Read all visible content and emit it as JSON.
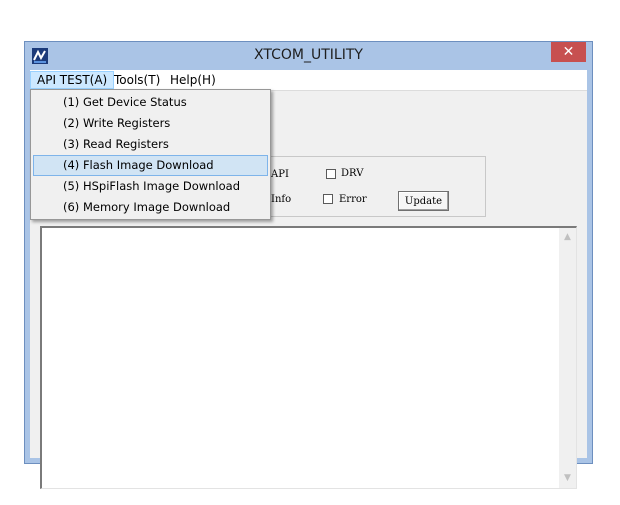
{
  "window": {
    "title": "XTCOM_UTILITY",
    "close_symbol": "✕",
    "icon": "app-logo-icon"
  },
  "menubar": {
    "items": [
      "API TEST(A)",
      "Tools(T)",
      "Help(H)"
    ],
    "active": "API TEST(A)"
  },
  "dropdown": {
    "items": [
      "(1) Get Device Status",
      "(2) Write Registers",
      "(3) Read Registers",
      "(4) Flash Image Download",
      "(5) HSpiFlash Image Download",
      "(6) Memory Image Download"
    ],
    "highlighted": "(4) Flash Image Download"
  },
  "options": {
    "api_label": "API",
    "drv_label": "DRV",
    "info_label": "Info",
    "error_label": "Error",
    "drv_checked": false,
    "error_checked": false,
    "update_label": "Update"
  },
  "scrollbar": {
    "up_symbol": "▲",
    "down_symbol": "▼"
  },
  "colors": {
    "frame": "#aac4e6",
    "close": "#c75050",
    "menu_highlight": "#d1e4f4"
  }
}
